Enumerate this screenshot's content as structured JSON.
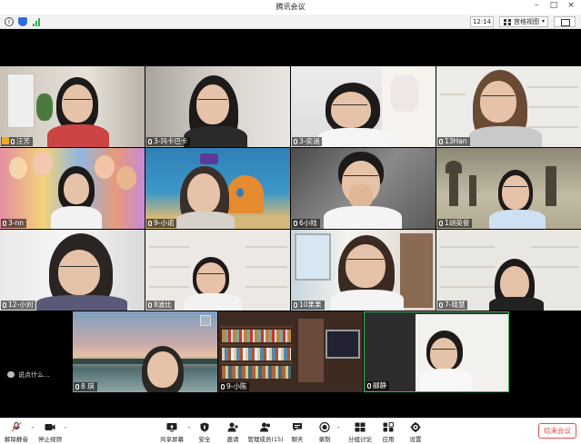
{
  "window": {
    "title": "腾讯会议"
  },
  "status": {
    "time": "12:14",
    "view_label": "宫格视图"
  },
  "tiles": [
    {
      "name": "汪芳",
      "badge": "host"
    },
    {
      "name": "3-玛卡巴卡"
    },
    {
      "name": "3-奕涵"
    },
    {
      "name": "13Han"
    },
    {
      "name": "3-nn"
    },
    {
      "name": "9-小诺"
    },
    {
      "name": "6小陆"
    },
    {
      "name": "1胡英俊"
    },
    {
      "name": "12-小刘"
    },
    {
      "name": "8波比"
    },
    {
      "name": "10果果"
    },
    {
      "name": "7-晓慧"
    },
    {
      "name": "8 琪"
    },
    {
      "name": "9-小陈"
    },
    {
      "name": "郦静"
    }
  ],
  "chat_hint": "说点什么...",
  "toolbar": {
    "unmute": "解除静音",
    "stop_video": "停止视频",
    "share": "共享屏幕",
    "security": "安全",
    "invite": "邀请",
    "members": "管理成员(15)",
    "chat": "聊天",
    "record": "录制",
    "breakout": "分组讨论",
    "apps": "应用",
    "settings": "设置",
    "end_meeting": "结束会议"
  },
  "colors": {
    "active_speaker_border": "#27c35a",
    "end_meeting": "#e54b4b",
    "signal": "#2bb34a"
  }
}
